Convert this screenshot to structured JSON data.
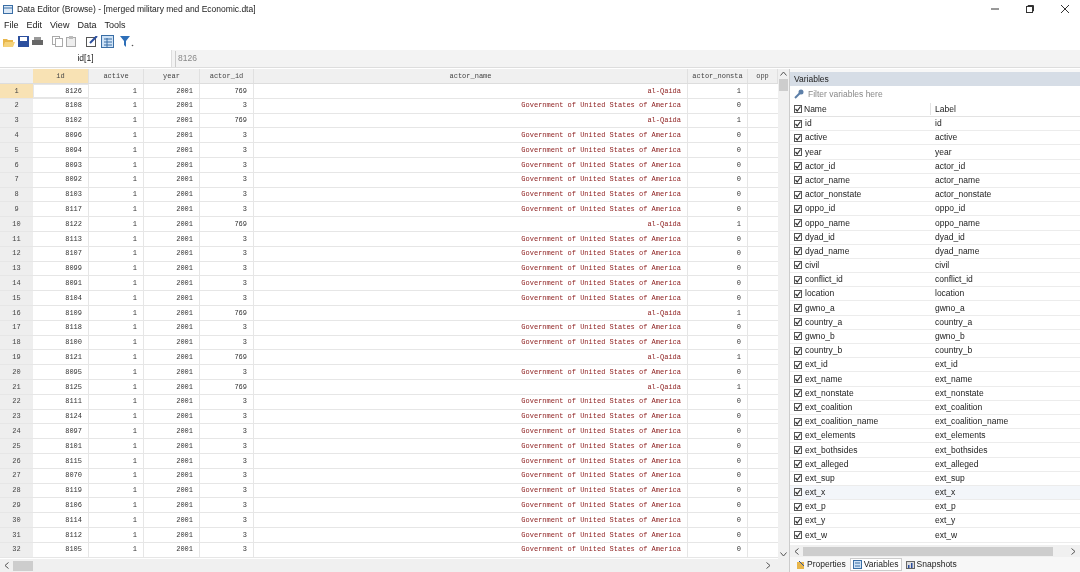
{
  "window": {
    "title": "Data Editor (Browse) - [merged military  med and Economic.dta]"
  },
  "menu": [
    "File",
    "Edit",
    "View",
    "Data",
    "Tools"
  ],
  "cell_editor": {
    "reference": "id[1]",
    "value": "8126"
  },
  "table": {
    "columns": [
      "id",
      "active",
      "year",
      "actor_id",
      "actor_name",
      "actor_nonsta",
      "opp"
    ],
    "rows": [
      {
        "num": "1",
        "cells": [
          "8126",
          "1",
          "2001",
          "769",
          "al-Qaida",
          "1"
        ],
        "selected": true
      },
      {
        "num": "2",
        "cells": [
          "8108",
          "1",
          "2001",
          "3",
          "Government of United States of America",
          "0"
        ],
        "selected": false
      },
      {
        "num": "3",
        "cells": [
          "8102",
          "1",
          "2001",
          "769",
          "al-Qaida",
          "1"
        ],
        "selected": false
      },
      {
        "num": "4",
        "cells": [
          "8096",
          "1",
          "2001",
          "3",
          "Government of United States of America",
          "0"
        ],
        "selected": false
      },
      {
        "num": "5",
        "cells": [
          "8094",
          "1",
          "2001",
          "3",
          "Government of United States of America",
          "0"
        ],
        "selected": false
      },
      {
        "num": "6",
        "cells": [
          "8093",
          "1",
          "2001",
          "3",
          "Government of United States of America",
          "0"
        ],
        "selected": false
      },
      {
        "num": "7",
        "cells": [
          "8092",
          "1",
          "2001",
          "3",
          "Government of United States of America",
          "0"
        ],
        "selected": false
      },
      {
        "num": "8",
        "cells": [
          "8103",
          "1",
          "2001",
          "3",
          "Government of United States of America",
          "0"
        ],
        "selected": false
      },
      {
        "num": "9",
        "cells": [
          "8117",
          "1",
          "2001",
          "3",
          "Government of United States of America",
          "0"
        ],
        "selected": false
      },
      {
        "num": "10",
        "cells": [
          "8122",
          "1",
          "2001",
          "769",
          "al-Qaida",
          "1"
        ],
        "selected": false
      },
      {
        "num": "11",
        "cells": [
          "8113",
          "1",
          "2001",
          "3",
          "Government of United States of America",
          "0"
        ],
        "selected": false
      },
      {
        "num": "12",
        "cells": [
          "8107",
          "1",
          "2001",
          "3",
          "Government of United States of America",
          "0"
        ],
        "selected": false
      },
      {
        "num": "13",
        "cells": [
          "8099",
          "1",
          "2001",
          "3",
          "Government of United States of America",
          "0"
        ],
        "selected": false
      },
      {
        "num": "14",
        "cells": [
          "8091",
          "1",
          "2001",
          "3",
          "Government of United States of America",
          "0"
        ],
        "selected": false
      },
      {
        "num": "15",
        "cells": [
          "8104",
          "1",
          "2001",
          "3",
          "Government of United States of America",
          "0"
        ],
        "selected": false
      },
      {
        "num": "16",
        "cells": [
          "8109",
          "1",
          "2001",
          "769",
          "al-Qaida",
          "1"
        ],
        "selected": false
      },
      {
        "num": "17",
        "cells": [
          "8118",
          "1",
          "2001",
          "3",
          "Government of United States of America",
          "0"
        ],
        "selected": false
      },
      {
        "num": "18",
        "cells": [
          "8100",
          "1",
          "2001",
          "3",
          "Government of United States of America",
          "0"
        ],
        "selected": false
      },
      {
        "num": "19",
        "cells": [
          "8121",
          "1",
          "2001",
          "769",
          "al-Qaida",
          "1"
        ],
        "selected": false
      },
      {
        "num": "20",
        "cells": [
          "8095",
          "1",
          "2001",
          "3",
          "Government of United States of America",
          "0"
        ],
        "selected": false
      },
      {
        "num": "21",
        "cells": [
          "8125",
          "1",
          "2001",
          "769",
          "al-Qaida",
          "1"
        ],
        "selected": false
      },
      {
        "num": "22",
        "cells": [
          "8111",
          "1",
          "2001",
          "3",
          "Government of United States of America",
          "0"
        ],
        "selected": false
      },
      {
        "num": "23",
        "cells": [
          "8124",
          "1",
          "2001",
          "3",
          "Government of United States of America",
          "0"
        ],
        "selected": false
      },
      {
        "num": "24",
        "cells": [
          "8097",
          "1",
          "2001",
          "3",
          "Government of United States of America",
          "0"
        ],
        "selected": false
      },
      {
        "num": "25",
        "cells": [
          "8101",
          "1",
          "2001",
          "3",
          "Government of United States of America",
          "0"
        ],
        "selected": false
      },
      {
        "num": "26",
        "cells": [
          "8115",
          "1",
          "2001",
          "3",
          "Government of United States of America",
          "0"
        ],
        "selected": false
      },
      {
        "num": "27",
        "cells": [
          "8070",
          "1",
          "2001",
          "3",
          "Government of United States of America",
          "0"
        ],
        "selected": false
      },
      {
        "num": "28",
        "cells": [
          "8119",
          "1",
          "2001",
          "3",
          "Government of United States of America",
          "0"
        ],
        "selected": false
      },
      {
        "num": "29",
        "cells": [
          "8106",
          "1",
          "2001",
          "3",
          "Government of United States of America",
          "0"
        ],
        "selected": false
      },
      {
        "num": "30",
        "cells": [
          "8114",
          "1",
          "2001",
          "3",
          "Government of United States of America",
          "0"
        ],
        "selected": false
      },
      {
        "num": "31",
        "cells": [
          "8112",
          "1",
          "2001",
          "3",
          "Government of United States of America",
          "0"
        ],
        "selected": false
      },
      {
        "num": "32",
        "cells": [
          "8105",
          "1",
          "2001",
          "3",
          "Government of United States of America",
          "0"
        ],
        "selected": false
      }
    ]
  },
  "variables": {
    "title": "Variables",
    "filter_placeholder": "Filter variables here",
    "header_checked": true,
    "columns": [
      "Name",
      "Label"
    ],
    "items": [
      {
        "name": "id",
        "label": "id",
        "checked": true
      },
      {
        "name": "active",
        "label": "active",
        "checked": true
      },
      {
        "name": "year",
        "label": "year",
        "checked": true
      },
      {
        "name": "actor_id",
        "label": "actor_id",
        "checked": true
      },
      {
        "name": "actor_name",
        "label": "actor_name",
        "checked": true
      },
      {
        "name": "actor_nonstate",
        "label": "actor_nonstate",
        "checked": true
      },
      {
        "name": "oppo_id",
        "label": "oppo_id",
        "checked": true
      },
      {
        "name": "oppo_name",
        "label": "oppo_name",
        "checked": true
      },
      {
        "name": "dyad_id",
        "label": "dyad_id",
        "checked": true
      },
      {
        "name": "dyad_name",
        "label": "dyad_name",
        "checked": true
      },
      {
        "name": "civil",
        "label": "civil",
        "checked": true
      },
      {
        "name": "conflict_id",
        "label": "conflict_id",
        "checked": true
      },
      {
        "name": "location",
        "label": "location",
        "checked": true
      },
      {
        "name": "gwno_a",
        "label": "gwno_a",
        "checked": true
      },
      {
        "name": "country_a",
        "label": "country_a",
        "checked": true
      },
      {
        "name": "gwno_b",
        "label": "gwno_b",
        "checked": true
      },
      {
        "name": "country_b",
        "label": "country_b",
        "checked": true
      },
      {
        "name": "ext_id",
        "label": "ext_id",
        "checked": true
      },
      {
        "name": "ext_name",
        "label": "ext_name",
        "checked": true
      },
      {
        "name": "ext_nonstate",
        "label": "ext_nonstate",
        "checked": true
      },
      {
        "name": "ext_coalition",
        "label": "ext_coalition",
        "checked": true
      },
      {
        "name": "ext_coalition_name",
        "label": "ext_coalition_name",
        "checked": true
      },
      {
        "name": "ext_elements",
        "label": "ext_elements",
        "checked": true
      },
      {
        "name": "ext_bothsides",
        "label": "ext_bothsides",
        "checked": true
      },
      {
        "name": "ext_alleged",
        "label": "ext_alleged",
        "checked": true
      },
      {
        "name": "ext_sup",
        "label": "ext_sup",
        "checked": true
      },
      {
        "name": "ext_x",
        "label": "ext_x",
        "checked": true
      },
      {
        "name": "ext_p",
        "label": "ext_p",
        "checked": true
      },
      {
        "name": "ext_y",
        "label": "ext_y",
        "checked": true
      },
      {
        "name": "ext_w",
        "label": "ext_w",
        "checked": true
      }
    ]
  },
  "panel_tabs": [
    {
      "label": "Properties",
      "selected": false
    },
    {
      "label": "Variables",
      "selected": true
    },
    {
      "label": "Snapshots",
      "selected": false
    }
  ]
}
